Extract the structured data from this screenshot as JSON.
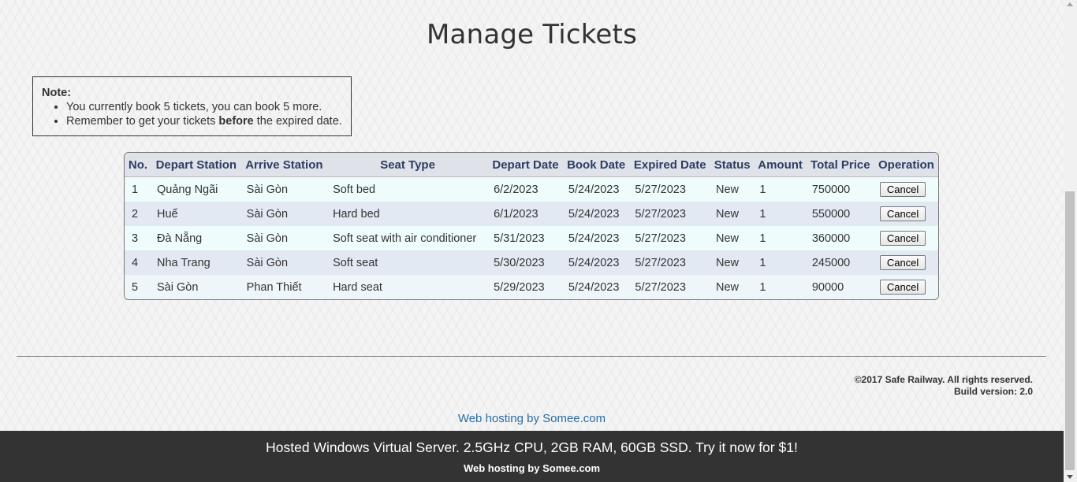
{
  "page_title": "Manage Tickets",
  "note": {
    "title": "Note:",
    "line1": "You currently book 5 tickets, you can book 5 more.",
    "line2_pre": "Remember to get your tickets ",
    "line2_bold": "before",
    "line2_post": " the expired date."
  },
  "table": {
    "headers": [
      "No.",
      "Depart Station",
      "Arrive Station",
      "Seat Type",
      "Depart Date",
      "Book Date",
      "Expired Date",
      "Status",
      "Amount",
      "Total Price",
      "Operation"
    ],
    "rows": [
      {
        "no": "1",
        "depart": "Quảng Ngãi",
        "arrive": "Sài Gòn",
        "seat": "Soft bed",
        "depart_date": "6/2/2023",
        "book_date": "5/24/2023",
        "expired_date": "5/27/2023",
        "status": "New",
        "amount": "1",
        "price": "750000",
        "op": "Cancel"
      },
      {
        "no": "2",
        "depart": "Huế",
        "arrive": "Sài Gòn",
        "seat": "Hard bed",
        "depart_date": "6/1/2023",
        "book_date": "5/24/2023",
        "expired_date": "5/27/2023",
        "status": "New",
        "amount": "1",
        "price": "550000",
        "op": "Cancel"
      },
      {
        "no": "3",
        "depart": "Đà Nẵng",
        "arrive": "Sài Gòn",
        "seat": "Soft seat with air conditioner",
        "depart_date": "5/31/2023",
        "book_date": "5/24/2023",
        "expired_date": "5/27/2023",
        "status": "New",
        "amount": "1",
        "price": "360000",
        "op": "Cancel"
      },
      {
        "no": "4",
        "depart": "Nha Trang",
        "arrive": "Sài Gòn",
        "seat": "Soft seat",
        "depart_date": "5/30/2023",
        "book_date": "5/24/2023",
        "expired_date": "5/27/2023",
        "status": "New",
        "amount": "1",
        "price": "245000",
        "op": "Cancel"
      },
      {
        "no": "5",
        "depart": "Sài Gòn",
        "arrive": "Phan Thiết",
        "seat": "Hard seat",
        "depart_date": "5/29/2023",
        "book_date": "5/24/2023",
        "expired_date": "5/27/2023",
        "status": "New",
        "amount": "1",
        "price": "90000",
        "op": "Cancel"
      }
    ]
  },
  "footer": {
    "copyright": "©2017 Safe Railway. All rights reserved.",
    "build": "Build version: 2.0",
    "host_link": "Web hosting by Somee.com"
  },
  "ad_bar": {
    "headline": "Hosted Windows Virtual Server. 2.5GHz CPU, 2GB RAM, 60GB SSD. Try it now for $1!",
    "sub": "Web hosting by Somee.com"
  },
  "colors": {
    "header_bg": "#e0e2ea",
    "header_text": "#2b3e60",
    "ad_bg": "#333333",
    "link": "#2b6ca3"
  }
}
